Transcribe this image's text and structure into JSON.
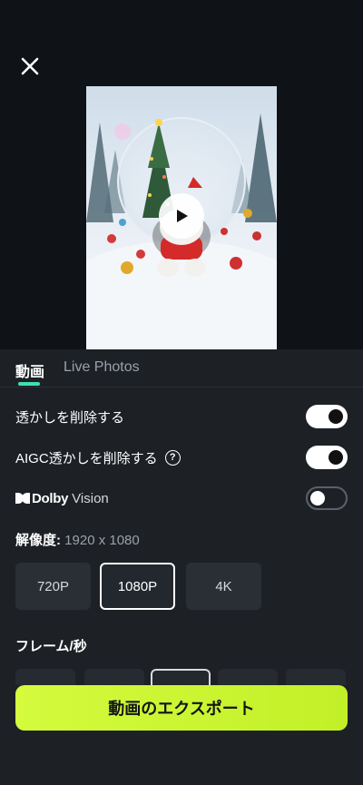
{
  "header": {
    "close_icon": "close-icon"
  },
  "preview": {
    "play_icon": "play-icon"
  },
  "tabs": [
    {
      "label": "動画",
      "active": true
    },
    {
      "label": "Live Photos",
      "active": false
    }
  ],
  "settings": {
    "remove_watermark": {
      "label": "透かしを削除する",
      "enabled": true
    },
    "remove_aigc_watermark": {
      "label": "AIGC透かしを削除する",
      "help_icon": "?",
      "enabled": true
    },
    "dolby_vision": {
      "brand": "Dolby",
      "label": "Vision",
      "enabled": false
    }
  },
  "resolution": {
    "label": "解像度:",
    "value": "1920 x 1080",
    "options": [
      "720P",
      "1080P",
      "4K"
    ],
    "selected": "1080P"
  },
  "fps": {
    "label": "フレーム/秒"
  },
  "export": {
    "label": "動画のエクスポート"
  },
  "colors": {
    "accent": "#3ee0b5",
    "export_button": "#c9f532",
    "background": "#0f1216",
    "sheet": "#1d2126"
  }
}
